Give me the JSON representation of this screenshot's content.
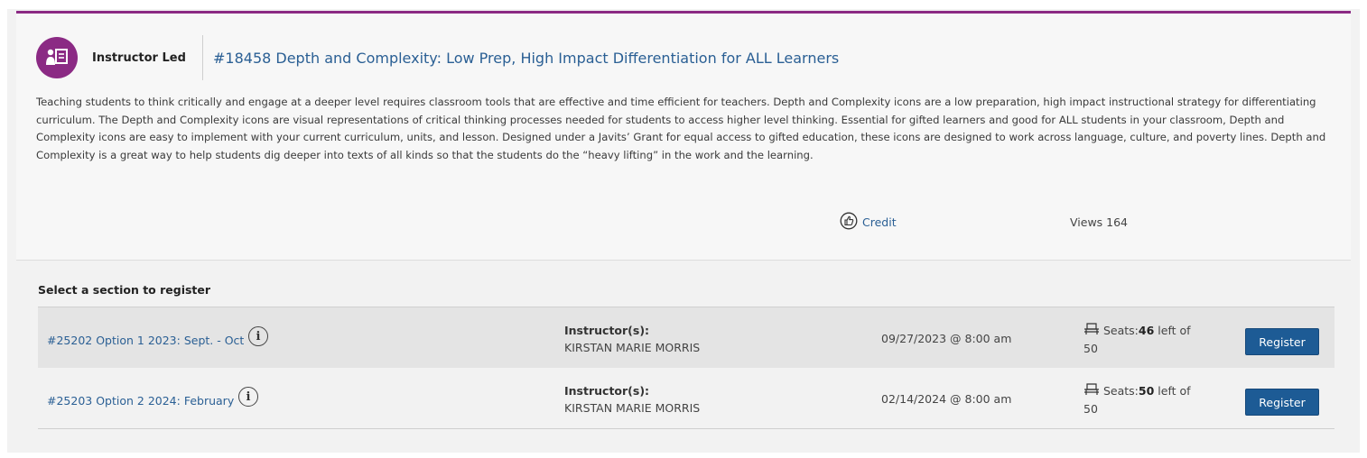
{
  "course": {
    "type_label": "Instructor Led",
    "title": "#18458 Depth and Complexity: Low Prep, High Impact Differentiation for ALL Learners",
    "description": "Teaching students to think critically and engage at a deeper level requires classroom tools that are effective and time efficient for teachers. Depth and Complexity icons are a low preparation, high impact instructional strategy for differentiating curriculum.  The Depth and Complexity icons are visual representations of critical thinking processes needed for students to access higher level thinking. Essential for gifted learners and good for ALL students in your classroom, Depth and Complexity icons are easy to implement with your current curriculum, units, and lesson.  Designed under a Javits’ Grant for equal access to gifted education, these icons are designed to work across language, culture, and poverty lines. Depth and Complexity is a great way to help students dig deeper into texts of all kinds so that the students do the “heavy lifting” in the work and the learning.",
    "credit_label": "Credit",
    "views_label": "Views 164",
    "accent_color": "#8b2a84",
    "type_icon": "instructor-led-icon"
  },
  "sections": {
    "heading": "Select a section to register",
    "rows": [
      {
        "link": "#25202 Option 1 2023: Sept. - Oct",
        "instructor_label": "Instructor(s):",
        "instructor_name": "KIRSTAN MARIE MORRIS",
        "date": "09/27/2023 @ 8:00 am",
        "seats_prefix": "Seats:",
        "seats_left": "46",
        "seats_suffix": " left of",
        "seats_total": "50",
        "register_label": "Register"
      },
      {
        "link": "#25203 Option 2 2024: February",
        "instructor_label": "Instructor(s):",
        "instructor_name": "KIRSTAN MARIE MORRIS",
        "date": "02/14/2024 @ 8:00 am",
        "seats_prefix": "Seats:",
        "seats_left": "50",
        "seats_suffix": " left of",
        "seats_total": "50",
        "register_label": "Register"
      }
    ]
  },
  "colors": {
    "link": "#2a5f94",
    "button": "#1d5b95"
  }
}
